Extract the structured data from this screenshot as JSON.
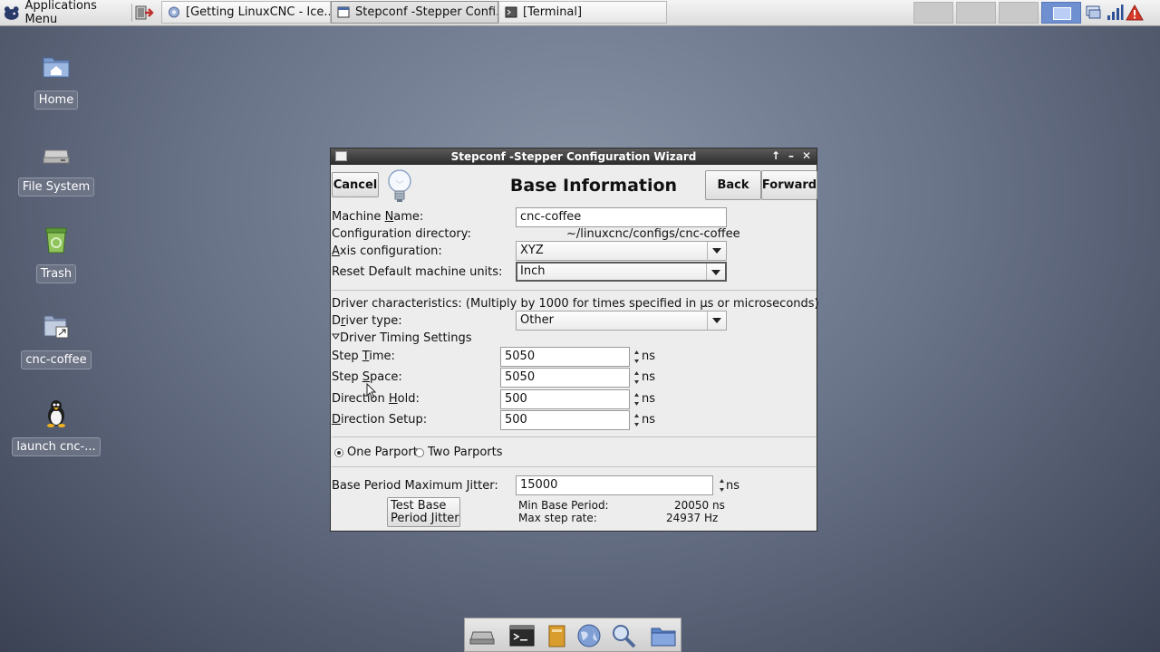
{
  "top_panel": {
    "app_menu_label": "Applications Menu",
    "tasks": [
      {
        "label": "[Getting LinuxCNC - Ice...",
        "icon": "iceweasel-icon"
      },
      {
        "label": "Stepconf -Stepper Confi...",
        "icon": "window-icon",
        "active": true
      },
      {
        "label": "[Terminal]",
        "icon": "terminal-icon"
      }
    ],
    "workspaces": 4,
    "active_workspace": 4,
    "tray_icons": [
      "network-icon",
      "signal-bars-icon",
      "warning-icon"
    ]
  },
  "desktop": {
    "icons": [
      {
        "label": "Home",
        "icon": "home-folder-icon"
      },
      {
        "label": "File System",
        "icon": "drive-icon"
      },
      {
        "label": "Trash",
        "icon": "trash-icon"
      },
      {
        "label": "cnc-coffee",
        "icon": "folder-link-icon"
      },
      {
        "label": "launch cnc-...",
        "icon": "tux-icon"
      }
    ]
  },
  "dialog": {
    "title": "Stepconf -Stepper Configuration Wizard",
    "titlebar_buttons": [
      "↑",
      "–",
      "✕"
    ],
    "cancel_label": "Cancel",
    "back_label": "Back",
    "forward_label": "Forward",
    "page_title": "Base Information",
    "machine_name_label": "Machine Name:",
    "machine_name_value": "cnc-coffee",
    "config_dir_label": "Configuration directory:",
    "config_dir_value": "~/linuxcnc/configs/cnc-coffee",
    "axis_config_label": "Axis configuration:",
    "axis_config_value": "XYZ",
    "units_label": "Reset Default machine units:",
    "units_value": "Inch",
    "driver_characteristics_label": "Driver characteristics: (Multiply by 1000 for times specified in µs or microseconds)",
    "driver_type_label": "Driver type:",
    "driver_type_value": "Other",
    "timing_expander_label": "Driver Timing Settings",
    "step_time_label": "Step Time:",
    "step_time_value": "5050",
    "step_space_label": "Step Space:",
    "step_space_value": "5050",
    "direction_hold_label": "Direction Hold:",
    "direction_hold_value": "500",
    "direction_setup_label": "Direction Setup:",
    "direction_setup_value": "500",
    "unit_ns": "ns",
    "one_parport_label": "One Parport",
    "two_parports_label": "Two Parports",
    "selected_parport": "One Parport",
    "jitter_label": "Base Period Maximum Jitter:",
    "jitter_value": "15000",
    "test_button_label_line1": "Test Base",
    "test_button_label_line2": "Period Jitter",
    "min_base_period_label": "Min Base Period:",
    "min_base_period_value": "20050 ns",
    "max_step_rate_label": "Max step rate:",
    "max_step_rate_value": "24937 Hz"
  },
  "dock": {
    "items": [
      "drive-icon",
      "terminal-icon",
      "notes-icon",
      "web-browser-icon",
      "search-icon",
      "folder-icon"
    ]
  },
  "colors": {
    "desktop_background": "#6a7489",
    "titlebar": "#2b2b2b",
    "active_workspace": "#6e8fd0",
    "warning": "#d83a2a"
  }
}
